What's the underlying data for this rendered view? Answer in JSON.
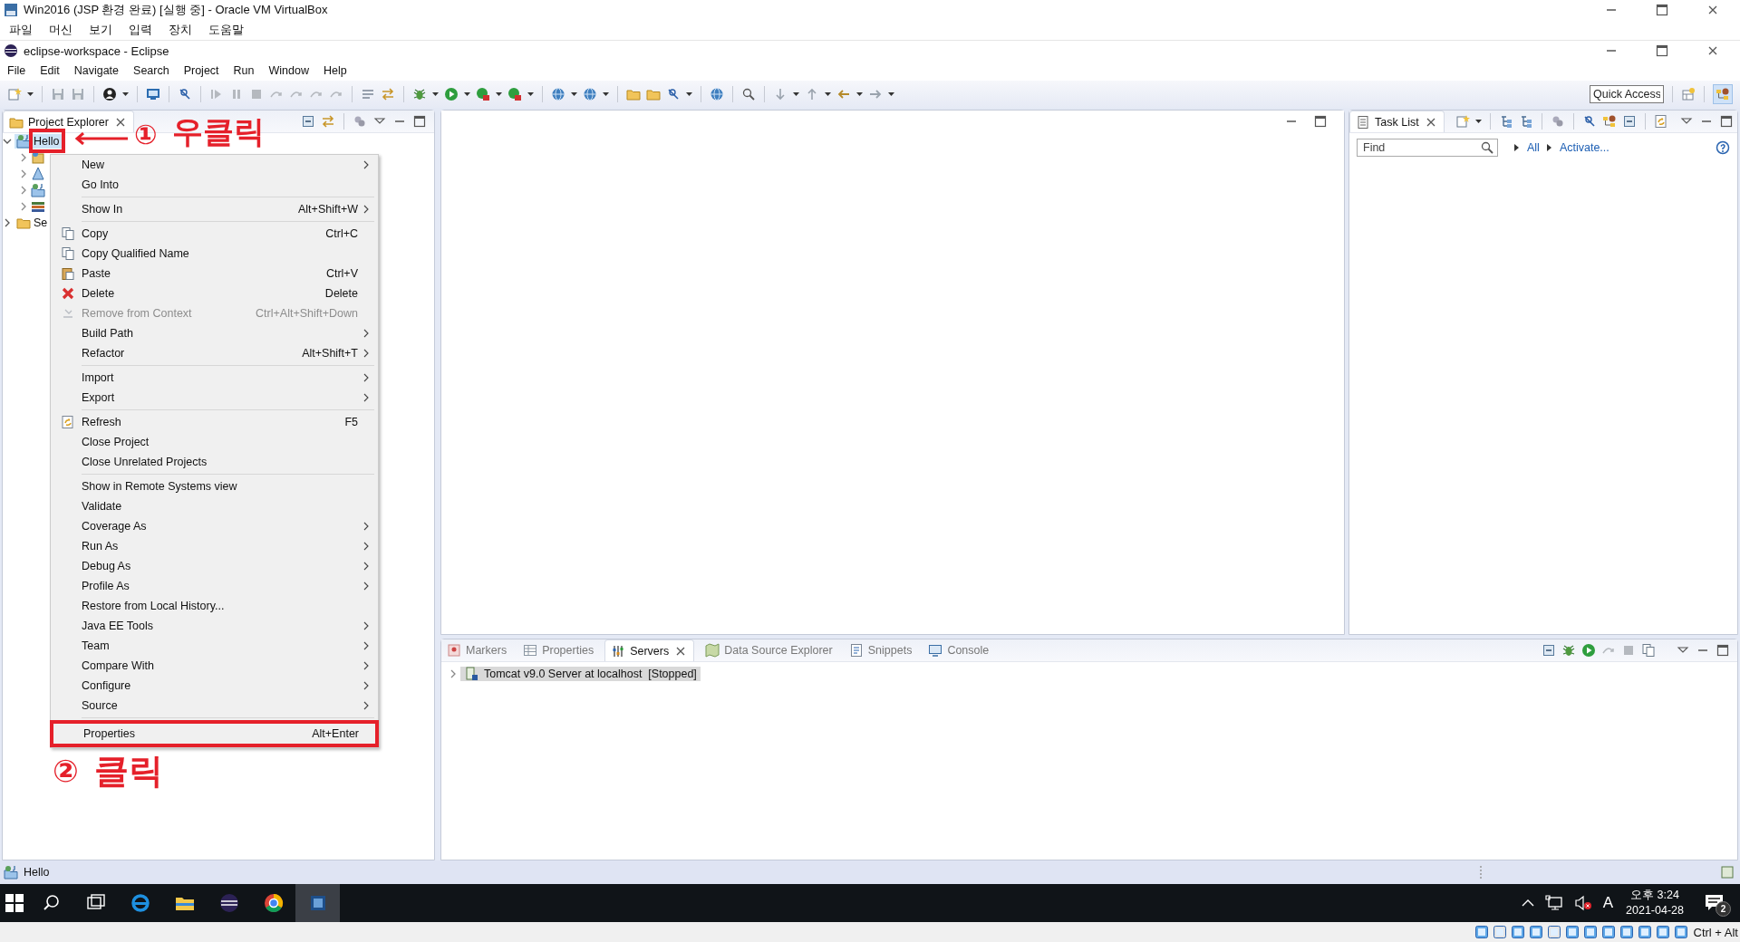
{
  "vbox": {
    "title": "Win2016 (JSP 환경 완료) [실행 중] - Oracle VM VirtualBox",
    "menu": [
      "파일",
      "머신",
      "보기",
      "입력",
      "장치",
      "도움말"
    ]
  },
  "eclipse": {
    "title": "eclipse-workspace - Eclipse",
    "menu": [
      "File",
      "Edit",
      "Navigate",
      "Search",
      "Project",
      "Run",
      "Window",
      "Help"
    ],
    "quick_access": {
      "placeholder": "Quick Access"
    }
  },
  "project_explorer": {
    "tab": "Project Explorer",
    "tree": [
      {
        "label": "Hello",
        "expanded": true,
        "selected": true,
        "children": [
          {
            "expanded": false
          },
          {
            "expanded": false
          },
          {
            "expanded": false
          },
          {
            "expanded": false
          }
        ]
      },
      {
        "label": "Se",
        "expanded": false,
        "selected": false
      }
    ]
  },
  "context_menu": {
    "groups": [
      [
        {
          "label": "New",
          "submenu": true,
          "disabled": false
        },
        {
          "label": "Go Into",
          "submenu": false,
          "disabled": false
        }
      ],
      [
        {
          "label": "Show In",
          "shortcut": "Alt+Shift+W",
          "submenu": true,
          "disabled": false
        }
      ],
      [
        {
          "label": "Copy",
          "shortcut": "Ctrl+C",
          "submenu": false,
          "disabled": false
        },
        {
          "label": "Copy Qualified Name",
          "submenu": false,
          "disabled": false
        },
        {
          "label": "Paste",
          "shortcut": "Ctrl+V",
          "submenu": false,
          "disabled": false
        },
        {
          "label": "Delete",
          "shortcut": "Delete",
          "submenu": false,
          "disabled": false
        },
        {
          "label": "Remove from Context",
          "shortcut": "Ctrl+Alt+Shift+Down",
          "submenu": false,
          "disabled": true
        },
        {
          "label": "Build Path",
          "submenu": true,
          "disabled": false
        },
        {
          "label": "Refactor",
          "shortcut": "Alt+Shift+T",
          "submenu": true,
          "disabled": false
        }
      ],
      [
        {
          "label": "Import",
          "submenu": true,
          "disabled": false
        },
        {
          "label": "Export",
          "submenu": true,
          "disabled": false
        }
      ],
      [
        {
          "label": "Refresh",
          "shortcut": "F5",
          "submenu": false,
          "disabled": false
        },
        {
          "label": "Close Project",
          "submenu": false,
          "disabled": false
        },
        {
          "label": "Close Unrelated Projects",
          "submenu": false,
          "disabled": false
        }
      ],
      [
        {
          "label": "Show in Remote Systems view",
          "submenu": false,
          "disabled": false
        },
        {
          "label": "Validate",
          "submenu": false,
          "disabled": false
        },
        {
          "label": "Coverage As",
          "submenu": true,
          "disabled": false
        },
        {
          "label": "Run As",
          "submenu": true,
          "disabled": false
        },
        {
          "label": "Debug As",
          "submenu": true,
          "disabled": false
        },
        {
          "label": "Profile As",
          "submenu": true,
          "disabled": false
        },
        {
          "label": "Restore from Local History...",
          "submenu": false,
          "disabled": false
        },
        {
          "label": "Java EE Tools",
          "submenu": true,
          "disabled": false
        },
        {
          "label": "Team",
          "submenu": true,
          "disabled": false
        },
        {
          "label": "Compare With",
          "submenu": true,
          "disabled": false
        },
        {
          "label": "Configure",
          "submenu": true,
          "disabled": false
        },
        {
          "label": "Source",
          "submenu": true,
          "disabled": false
        }
      ],
      [
        {
          "label": "Properties",
          "shortcut": "Alt+Enter",
          "submenu": false,
          "disabled": false
        }
      ]
    ]
  },
  "annotations": [
    {
      "number": "①",
      "text": "우클릭"
    },
    {
      "number": "②",
      "text": "클릭"
    }
  ],
  "task_list": {
    "tab": "Task List",
    "find": {
      "placeholder": "Find"
    },
    "links": [
      "All",
      "Activate..."
    ]
  },
  "bottom_panel": {
    "tabs": [
      {
        "label": "Markers",
        "selected": false
      },
      {
        "label": "Properties",
        "selected": false
      },
      {
        "label": "Servers",
        "selected": true
      },
      {
        "label": "Data Source Explorer",
        "selected": false
      },
      {
        "label": "Snippets",
        "selected": false
      },
      {
        "label": "Console",
        "selected": false
      }
    ],
    "servers": [
      {
        "label": "Tomcat v9.0 Server at localhost  [Stopped]",
        "selected": true,
        "expanded": false
      }
    ]
  },
  "status_bar": {
    "text": "Hello"
  },
  "taskbar": {
    "apps": [
      {
        "selected": false
      },
      {
        "selected": false
      },
      {
        "selected": false
      },
      {
        "selected": false
      },
      {
        "selected": false
      },
      {
        "selected": false
      },
      {
        "selected": true
      }
    ]
  },
  "tray": {
    "ime": "A",
    "time": "오후 3:24",
    "date": "2021-04-28",
    "notifications": "2"
  },
  "vbox_status": {
    "hostkey": "Ctrl + Alt"
  }
}
